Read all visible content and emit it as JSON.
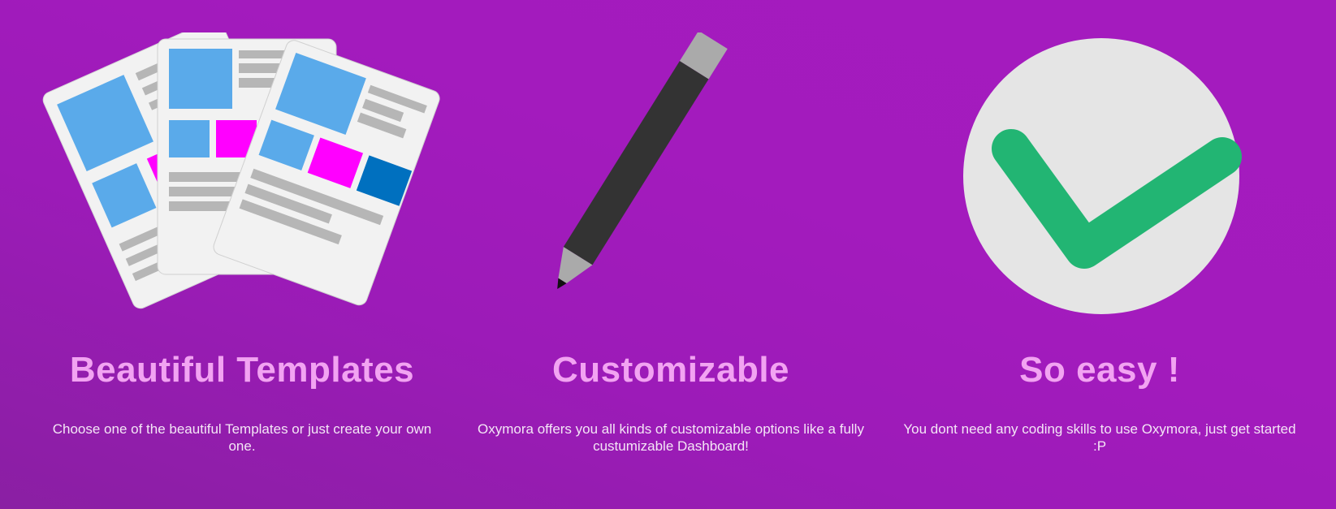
{
  "colors": {
    "background": "#a31bbd",
    "title": "#f2a3f2",
    "description": "#f4e6f6",
    "doc_blue": "#5aaaea",
    "doc_magenta": "#ff00ff",
    "doc_dark_blue": "#0070bf",
    "doc_gray_line": "#b6b6b6",
    "paper": "#f2f2f2",
    "pencil_body": "#333333",
    "pencil_tip": "#aaaaaa",
    "check_circle": "#e5e5e5",
    "check_mark": "#22b573"
  },
  "features": [
    {
      "icon": "documents-stack-icon",
      "title": "Beautiful Templates",
      "description": "Choose one of the beautiful Templates or just create your own one."
    },
    {
      "icon": "pencil-icon",
      "title": "Customizable",
      "description": "Oxymora offers you all kinds of customizable options like a fully custumizable Dashboard!"
    },
    {
      "icon": "checkmark-circle-icon",
      "title": "So easy !",
      "description": "You dont need any coding skills to use Oxymora, just get started :P"
    }
  ]
}
